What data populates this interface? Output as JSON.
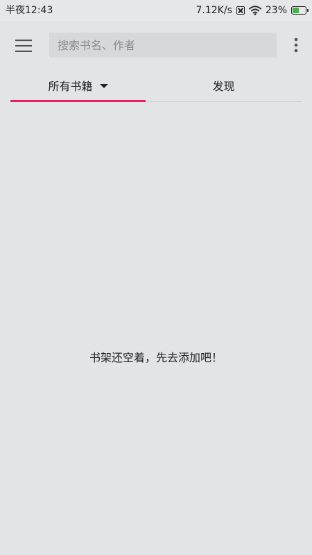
{
  "status_bar": {
    "time": "半夜12:43",
    "speed": "7.12K/s",
    "battery": "23%",
    "battery_level": 0.23,
    "icons": [
      "sim-disabled-icon",
      "wifi-icon",
      "battery-charging-icon"
    ]
  },
  "toolbar": {
    "menu_icon": "hamburger-menu-icon",
    "search_placeholder": "搜索书名、作者",
    "search_value": "",
    "more_icon": "more-vertical-icon"
  },
  "tabs": [
    {
      "label": "所有书籍",
      "active": true,
      "has_dropdown": true
    },
    {
      "label": "发现",
      "active": false
    }
  ],
  "content": {
    "empty_message": "书架还空着，先去添加吧！"
  },
  "colors": {
    "accent": "#e91e63",
    "background": "#e3e4e6",
    "search_bg": "#d7d8da",
    "battery_fill": "#4caf50"
  }
}
